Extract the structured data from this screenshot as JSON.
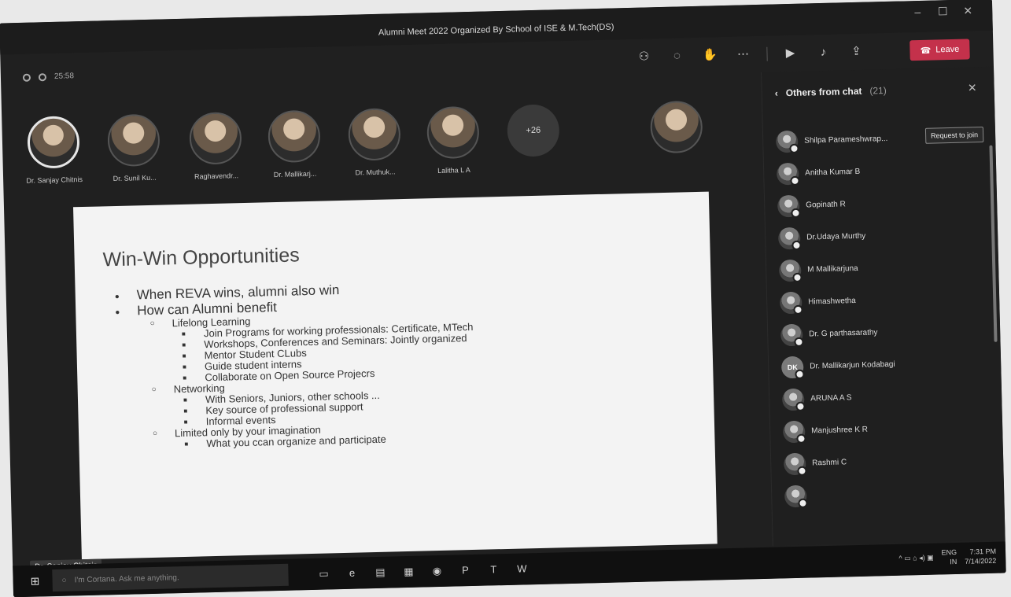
{
  "window": {
    "title": "Alumni Meet 2022 Organized By School of ISE & M.Tech(DS)"
  },
  "toolbar": {
    "leave_label": "Leave"
  },
  "meeting": {
    "timer": "25:58"
  },
  "participants": [
    {
      "name": "Dr. Sanjay Chitnis",
      "active": true
    },
    {
      "name": "Dr. Sunil Ku..."
    },
    {
      "name": "Raghavendr..."
    },
    {
      "name": "Dr. Mallikarj..."
    },
    {
      "name": "Dr. Muthuk..."
    },
    {
      "name": "Lalitha L A"
    },
    {
      "name": "",
      "more": "+26"
    },
    {
      "name": ""
    }
  ],
  "slide": {
    "title": "Win-Win Opportunities",
    "bullets": [
      {
        "level": 1,
        "text": "When REVA wins, alumni also win"
      },
      {
        "level": 1,
        "text": "How can Alumni benefit"
      },
      {
        "level": 2,
        "text": "Lifelong Learning"
      },
      {
        "level": 3,
        "text": "Join Programs for working professionals: Certificate, MTech"
      },
      {
        "level": 3,
        "text": "Workshops, Conferences and Seminars: Jointly organized"
      },
      {
        "level": 3,
        "text": "Mentor Student CLubs"
      },
      {
        "level": 3,
        "text": "Guide student interns"
      },
      {
        "level": 3,
        "text": "Collaborate on Open Source Projecrs"
      },
      {
        "level": 2,
        "text": "Networking"
      },
      {
        "level": 3,
        "text": "With Seniors, Juniors, other schools ..."
      },
      {
        "level": 3,
        "text": "Key source of professional support"
      },
      {
        "level": 3,
        "text": "Informal events"
      },
      {
        "level": 2,
        "text": "Limited only by your imagination"
      },
      {
        "level": 3,
        "text": "What you ccan organize and participate"
      }
    ],
    "presenter": "Dr. Sanjay Chitnis"
  },
  "chat_panel": {
    "title": "Others from chat",
    "count": "(21)",
    "request_label": "Request to join",
    "people": [
      {
        "name": "Shilpa Parameshwrap...",
        "request": true
      },
      {
        "name": "Anitha Kumar B"
      },
      {
        "name": "Gopinath R"
      },
      {
        "name": "Dr.Udaya Murthy"
      },
      {
        "name": "M Mallikarjuna"
      },
      {
        "name": "Himashwetha"
      },
      {
        "name": "Dr. G parthasarathy"
      },
      {
        "name": "Dr. Mallikarjun Kodabagi",
        "initials": "DK"
      },
      {
        "name": "ARUNA A S"
      },
      {
        "name": "Manjushree K R"
      },
      {
        "name": "Rashmi C"
      },
      {
        "name": ""
      }
    ]
  },
  "taskbar": {
    "search_placeholder": "I'm Cortana. Ask me anything.",
    "lang": "ENG",
    "region": "IN",
    "time": "7:31 PM",
    "date": "7/14/2022"
  },
  "icons": {
    "people": "people-icon",
    "chat": "chat-icon",
    "reactions": "raise-hand-icon",
    "more": "more-icon",
    "camera": "camera-off-icon",
    "mic": "mic-off-icon",
    "share": "share-icon",
    "phone": "phone-icon"
  }
}
